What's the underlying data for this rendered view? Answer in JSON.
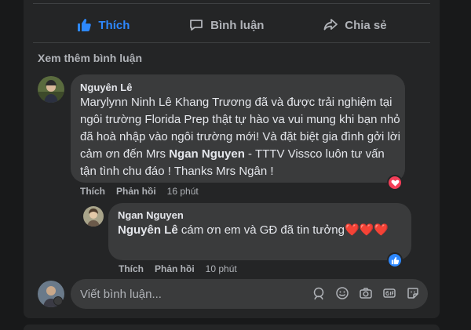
{
  "actions": {
    "like": "Thích",
    "comment": "Bình luận",
    "share": "Chia sẻ"
  },
  "more_comments": "Xem thêm bình luận",
  "comment1": {
    "author": "Nguyên Lê",
    "text_a": "Marylynn Ninh Lê Khang Trương đã và được trải nghiệm tại ngôi trường Florida Prep thật tự hào va vui mung khi bạn nhỏ đã hoà nhập vào ngôi trường mới! Và đặt biệt gia đình gởi lời cảm ơn đến Mrs ",
    "mention": "Ngan Nguyen",
    "text_b": " - TTTV Vissco luôn tư vấn tận tình chu đáo ! Thanks Mrs Ngân !",
    "like_label": "Thích",
    "reply_label": "Phản hồi",
    "time": "16 phút",
    "reaction": "heart"
  },
  "reply1": {
    "author": "Ngan Nguyen",
    "mention": "Nguyên Lê",
    "text": " cám ơn em và GĐ đã tin tưởng",
    "hearts": "❤️❤️❤️",
    "like_label": "Thích",
    "reply_label": "Phản hồi",
    "time": "10 phút",
    "reaction": "like"
  },
  "write": {
    "placeholder": "Viết bình luận..."
  },
  "icons": [
    "emoji-icon",
    "camera-icon",
    "gif-icon",
    "sticker-icon"
  ],
  "colors": {
    "accent": "#2d88ff",
    "heart": "#f33e58",
    "bubble": "#3a3b3c",
    "card": "#242526"
  }
}
